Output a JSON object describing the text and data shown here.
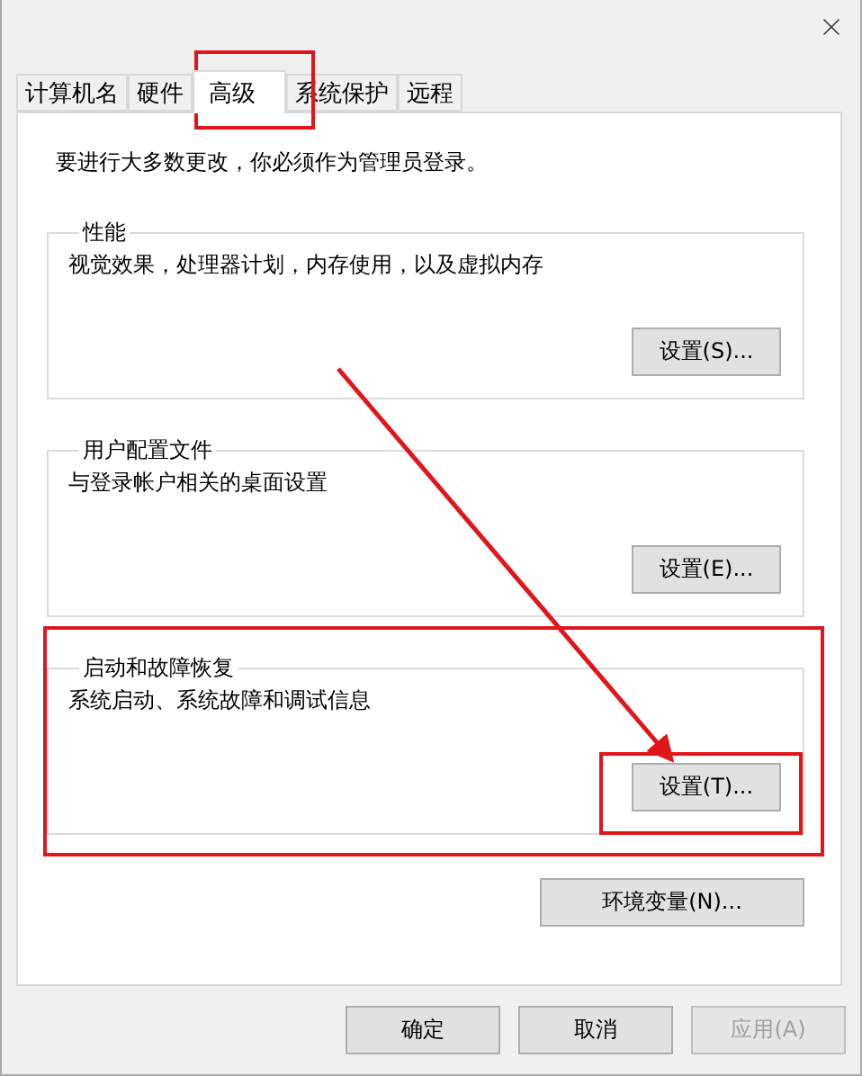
{
  "tabs": [
    {
      "label": "计算机名",
      "selected": false
    },
    {
      "label": "硬件",
      "selected": false
    },
    {
      "label": "高级",
      "selected": true
    },
    {
      "label": "系统保护",
      "selected": false
    },
    {
      "label": "远程",
      "selected": false
    }
  ],
  "notice": "要进行大多数更改，你必须作为管理员登录。",
  "groups": [
    {
      "title": "性能",
      "description": "视觉效果，处理器计划，内存使用，以及虚拟内存",
      "button": "设置(S)..."
    },
    {
      "title": "用户配置文件",
      "description": "与登录帐户相关的桌面设置",
      "button": "设置(E)..."
    },
    {
      "title": "启动和故障恢复",
      "description": "系统启动、系统故障和调试信息",
      "button": "设置(T)..."
    }
  ],
  "env_button": "环境变量(N)...",
  "buttons": [
    {
      "label": "确定",
      "disabled": false
    },
    {
      "label": "取消",
      "disabled": false
    },
    {
      "label": "应用(A)",
      "disabled": true
    }
  ]
}
